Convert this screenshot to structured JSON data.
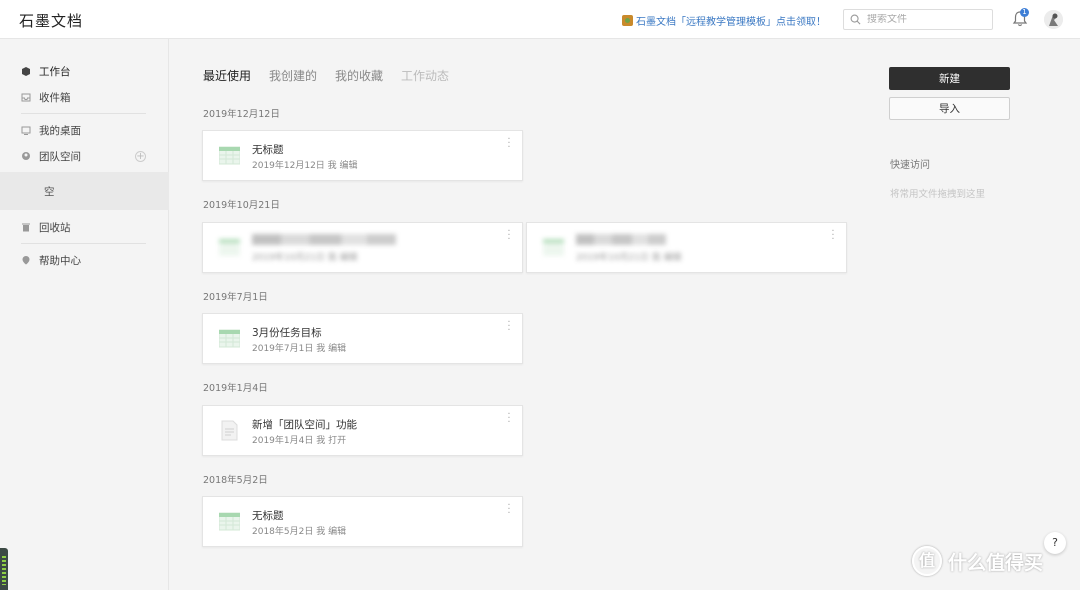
{
  "app": {
    "logo": "石墨文档"
  },
  "header": {
    "promo_text": "石墨文档「远程教学管理模板」点击领取！",
    "search_placeholder": "搜索文件",
    "notification_count": "1"
  },
  "sidebar": {
    "items": [
      {
        "label": "工作台",
        "icon": "workspace-icon"
      },
      {
        "label": "收件箱",
        "icon": "inbox-icon"
      },
      {
        "label": "我的桌面",
        "icon": "desktop-icon"
      },
      {
        "label": "团队空间",
        "icon": "team-icon"
      },
      {
        "label": "回收站",
        "icon": "trash-icon"
      },
      {
        "label": "帮助中心",
        "icon": "help-center-icon"
      }
    ],
    "team_empty": "空",
    "add_symbol": "+"
  },
  "tabs": [
    {
      "label": "最近使用",
      "state": "active"
    },
    {
      "label": "我创建的",
      "state": "normal"
    },
    {
      "label": "我的收藏",
      "state": "normal"
    },
    {
      "label": "工作动态",
      "state": "disabled"
    }
  ],
  "groups": [
    {
      "date": "2019年12月12日",
      "files": [
        {
          "title": "无标题",
          "meta": "2019年12月12日 我 编辑",
          "type": "sheet"
        }
      ]
    },
    {
      "date": "2019年10月21日",
      "files": [
        {
          "title": "",
          "meta": "2019年10月21日 我 编辑",
          "type": "sheet",
          "blurred": true
        },
        {
          "title": "",
          "meta": "2019年10月21日 我 编辑",
          "type": "sheet",
          "blurred": true
        }
      ]
    },
    {
      "date": "2019年7月1日",
      "files": [
        {
          "title": "3月份任务目标",
          "meta": "2019年7月1日 我 编辑",
          "type": "sheet"
        }
      ]
    },
    {
      "date": "2019年1月4日",
      "files": [
        {
          "title": "新增「团队空间」功能",
          "meta": "2019年1月4日 我 打开",
          "type": "doc"
        }
      ]
    },
    {
      "date": "2018年5月2日",
      "files": [
        {
          "title": "无标题",
          "meta": "2018年5月2日 我 编辑",
          "type": "sheet"
        }
      ]
    }
  ],
  "actions": {
    "new_label": "新建",
    "import_label": "导入"
  },
  "quick_access": {
    "title": "快速访问",
    "hint": "将常用文件拖拽到这里"
  },
  "help_button": "?",
  "watermark": {
    "text": "什么值得买",
    "icon_char": "值"
  },
  "colors": {
    "accent": "#3a78c3",
    "primary_button": "#2f2f2f",
    "sheet_green": "#9fd3a8"
  }
}
